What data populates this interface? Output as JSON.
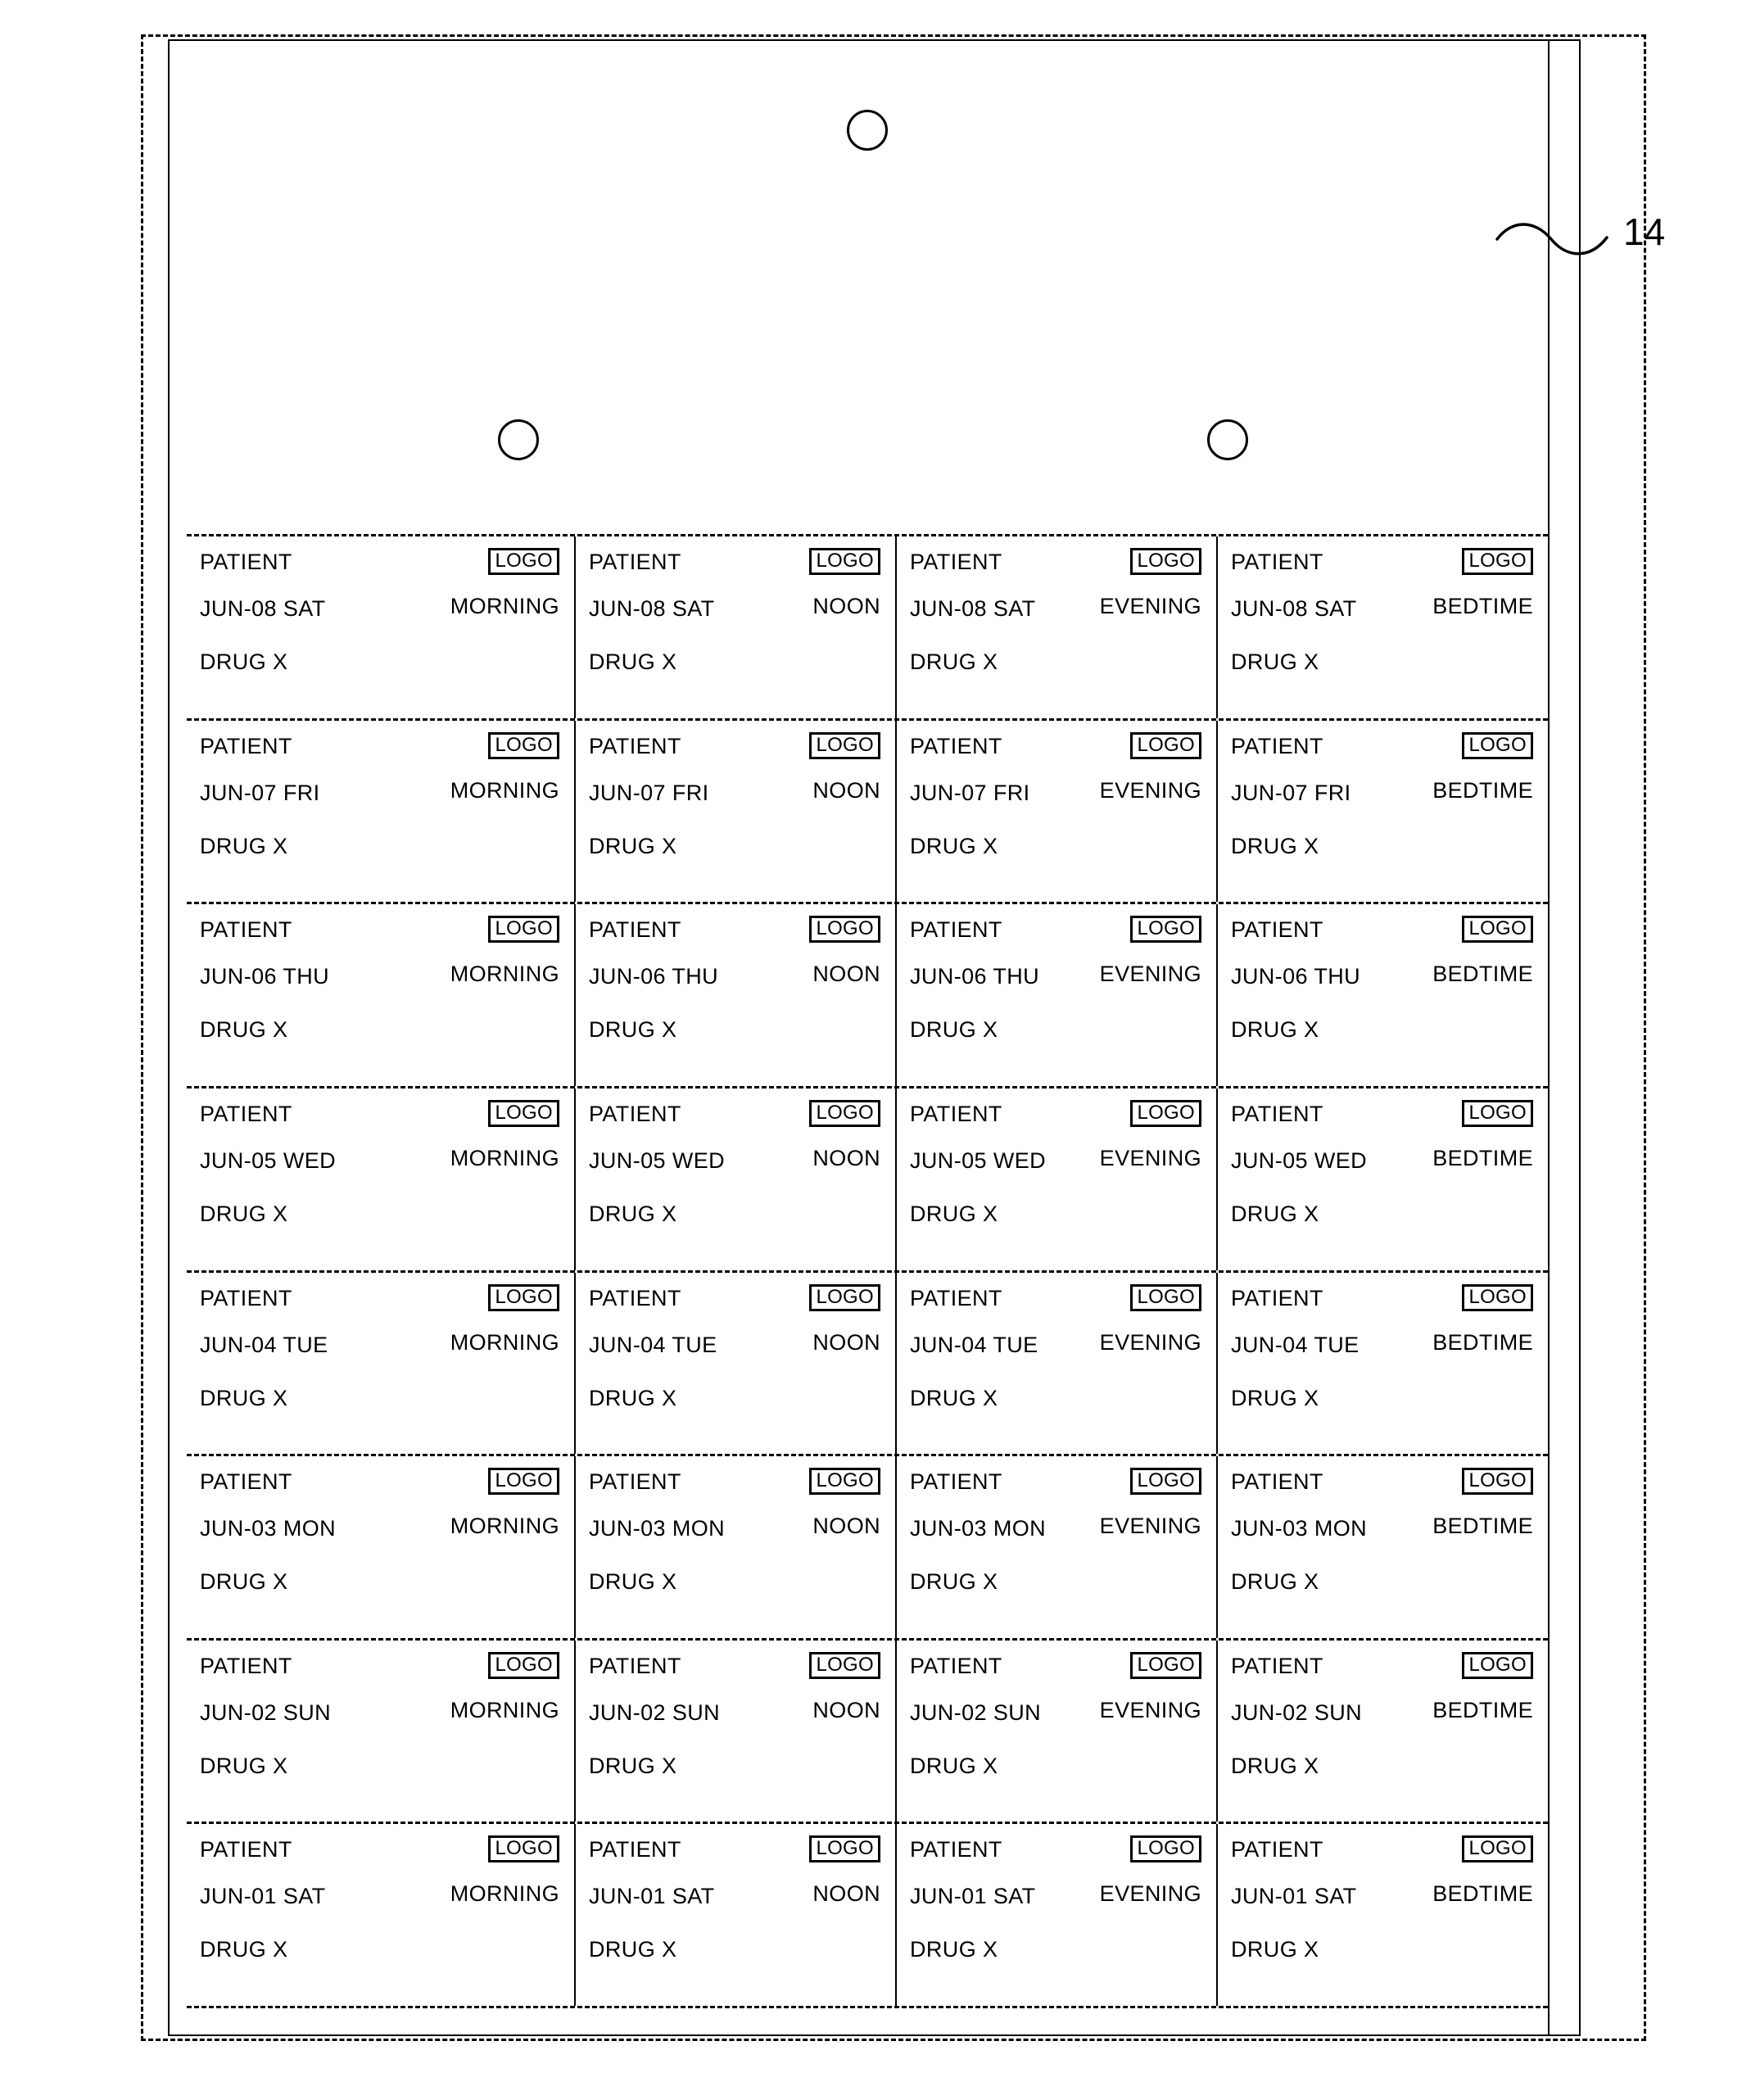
{
  "figure": {
    "reference_numeral": "14"
  },
  "label_sheet": {
    "columns": [
      {
        "id": "morning",
        "time_label": "MORNING"
      },
      {
        "id": "noon",
        "time_label": "NOON"
      },
      {
        "id": "evening",
        "time_label": "EVENING"
      },
      {
        "id": "bedtime",
        "time_label": "BEDTIME"
      }
    ],
    "common": {
      "patient_label": "PATIENT",
      "drug_label": "DRUG X",
      "logo_label": "LOGO"
    },
    "rows": [
      {
        "date": "JUN-08 SAT"
      },
      {
        "date": "JUN-07 FRI"
      },
      {
        "date": "JUN-06 THU"
      },
      {
        "date": "JUN-05 WED"
      },
      {
        "date": "JUN-04 TUE"
      },
      {
        "date": "JUN-03 MON"
      },
      {
        "date": "JUN-02 SUN"
      },
      {
        "date": "JUN-01 SAT"
      }
    ],
    "cells": [
      [
        {
          "patient": "PATIENT",
          "date": "JUN-08 SAT",
          "drug": "DRUG X",
          "logo": "LOGO",
          "time": "MORNING"
        },
        {
          "patient": "PATIENT",
          "date": "JUN-08 SAT",
          "drug": "DRUG X",
          "logo": "LOGO",
          "time": "NOON"
        },
        {
          "patient": "PATIENT",
          "date": "JUN-08 SAT",
          "drug": "DRUG X",
          "logo": "LOGO",
          "time": "EVENING"
        },
        {
          "patient": "PATIENT",
          "date": "JUN-08 SAT",
          "drug": "DRUG X",
          "logo": "LOGO",
          "time": "BEDTIME"
        }
      ],
      [
        {
          "patient": "PATIENT",
          "date": "JUN-07 FRI",
          "drug": "DRUG X",
          "logo": "LOGO",
          "time": "MORNING"
        },
        {
          "patient": "PATIENT",
          "date": "JUN-07 FRI",
          "drug": "DRUG X",
          "logo": "LOGO",
          "time": "NOON"
        },
        {
          "patient": "PATIENT",
          "date": "JUN-07 FRI",
          "drug": "DRUG X",
          "logo": "LOGO",
          "time": "EVENING"
        },
        {
          "patient": "PATIENT",
          "date": "JUN-07 FRI",
          "drug": "DRUG X",
          "logo": "LOGO",
          "time": "BEDTIME"
        }
      ],
      [
        {
          "patient": "PATIENT",
          "date": "JUN-06 THU",
          "drug": "DRUG X",
          "logo": "LOGO",
          "time": "MORNING"
        },
        {
          "patient": "PATIENT",
          "date": "JUN-06 THU",
          "drug": "DRUG X",
          "logo": "LOGO",
          "time": "NOON"
        },
        {
          "patient": "PATIENT",
          "date": "JUN-06 THU",
          "drug": "DRUG X",
          "logo": "LOGO",
          "time": "EVENING"
        },
        {
          "patient": "PATIENT",
          "date": "JUN-06 THU",
          "drug": "DRUG X",
          "logo": "LOGO",
          "time": "BEDTIME"
        }
      ],
      [
        {
          "patient": "PATIENT",
          "date": "JUN-05 WED",
          "drug": "DRUG X",
          "logo": "LOGO",
          "time": "MORNING"
        },
        {
          "patient": "PATIENT",
          "date": "JUN-05 WED",
          "drug": "DRUG X",
          "logo": "LOGO",
          "time": "NOON"
        },
        {
          "patient": "PATIENT",
          "date": "JUN-05 WED",
          "drug": "DRUG X",
          "logo": "LOGO",
          "time": "EVENING"
        },
        {
          "patient": "PATIENT",
          "date": "JUN-05 WED",
          "drug": "DRUG X",
          "logo": "LOGO",
          "time": "BEDTIME"
        }
      ],
      [
        {
          "patient": "PATIENT",
          "date": "JUN-04 TUE",
          "drug": "DRUG X",
          "logo": "LOGO",
          "time": "MORNING"
        },
        {
          "patient": "PATIENT",
          "date": "JUN-04 TUE",
          "drug": "DRUG X",
          "logo": "LOGO",
          "time": "NOON"
        },
        {
          "patient": "PATIENT",
          "date": "JUN-04 TUE",
          "drug": "DRUG X",
          "logo": "LOGO",
          "time": "EVENING"
        },
        {
          "patient": "PATIENT",
          "date": "JUN-04 TUE",
          "drug": "DRUG X",
          "logo": "LOGO",
          "time": "BEDTIME"
        }
      ],
      [
        {
          "patient": "PATIENT",
          "date": "JUN-03 MON",
          "drug": "DRUG X",
          "logo": "LOGO",
          "time": "MORNING"
        },
        {
          "patient": "PATIENT",
          "date": "JUN-03 MON",
          "drug": "DRUG X",
          "logo": "LOGO",
          "time": "NOON"
        },
        {
          "patient": "PATIENT",
          "date": "JUN-03 MON",
          "drug": "DRUG X",
          "logo": "LOGO",
          "time": "EVENING"
        },
        {
          "patient": "PATIENT",
          "date": "JUN-03 MON",
          "drug": "DRUG X",
          "logo": "LOGO",
          "time": "BEDTIME"
        }
      ],
      [
        {
          "patient": "PATIENT",
          "date": "JUN-02 SUN",
          "drug": "DRUG X",
          "logo": "LOGO",
          "time": "MORNING"
        },
        {
          "patient": "PATIENT",
          "date": "JUN-02 SUN",
          "drug": "DRUG X",
          "logo": "LOGO",
          "time": "NOON"
        },
        {
          "patient": "PATIENT",
          "date": "JUN-02 SUN",
          "drug": "DRUG X",
          "logo": "LOGO",
          "time": "EVENING"
        },
        {
          "patient": "PATIENT",
          "date": "JUN-02 SUN",
          "drug": "DRUG X",
          "logo": "LOGO",
          "time": "BEDTIME"
        }
      ],
      [
        {
          "patient": "PATIENT",
          "date": "JUN-01 SAT",
          "drug": "DRUG X",
          "logo": "LOGO",
          "time": "MORNING"
        },
        {
          "patient": "PATIENT",
          "date": "JUN-01 SAT",
          "drug": "DRUG X",
          "logo": "LOGO",
          "time": "NOON"
        },
        {
          "patient": "PATIENT",
          "date": "JUN-01 SAT",
          "drug": "DRUG X",
          "logo": "LOGO",
          "time": "EVENING"
        },
        {
          "patient": "PATIENT",
          "date": "JUN-01 SAT",
          "drug": "DRUG X",
          "logo": "LOGO",
          "time": "BEDTIME"
        }
      ]
    ]
  },
  "colors": {
    "ink": "#000000",
    "paper": "#ffffff"
  }
}
